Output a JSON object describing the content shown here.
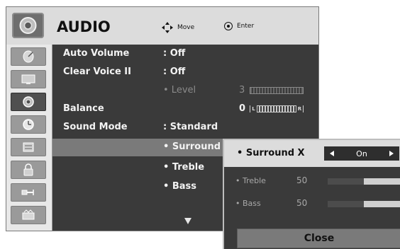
{
  "header": {
    "title": "AUDIO",
    "hint_move": "Move",
    "hint_enter": "Enter"
  },
  "sidebar": {
    "items": [
      {
        "icon": "satellite-dish-icon"
      },
      {
        "icon": "monitor-icon"
      },
      {
        "icon": "speaker-icon",
        "active": true
      },
      {
        "icon": "clock-icon"
      },
      {
        "icon": "options-icon"
      },
      {
        "icon": "lock-icon"
      },
      {
        "icon": "input-plug-icon"
      },
      {
        "icon": "usb-media-icon"
      }
    ]
  },
  "settings": {
    "auto_volume": {
      "label": "Auto Volume",
      "value": ": Off"
    },
    "clear_voice": {
      "label": "Clear Voice II",
      "value": ": Off"
    },
    "level": {
      "label": "• Level",
      "value": "3"
    },
    "balance": {
      "label": "Balance",
      "value": "0",
      "bar_left": "L",
      "bar_right": "R"
    },
    "sound_mode": {
      "label": "Sound Mode",
      "value": ": Standard"
    },
    "surround": {
      "label": "• Surround X"
    },
    "treble": {
      "label": "• Treble"
    },
    "bass": {
      "label": "• Bass"
    }
  },
  "popup": {
    "title": "• Surround X",
    "selected": "On",
    "treble": {
      "label": "• Treble",
      "value": "50",
      "level": 0.5
    },
    "bass": {
      "label": "• Bass",
      "value": "50",
      "level": 0.5
    },
    "close_label": "Close"
  }
}
